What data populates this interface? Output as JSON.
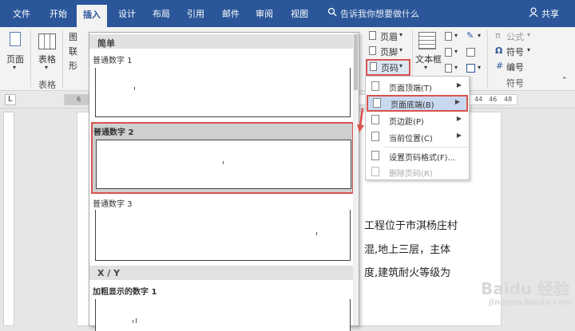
{
  "tabs": [
    {
      "label": "文件"
    },
    {
      "label": "开始"
    },
    {
      "label": "插入",
      "active": true
    },
    {
      "label": "设计"
    },
    {
      "label": "布局"
    },
    {
      "label": "引用"
    },
    {
      "label": "邮件"
    },
    {
      "label": "审阅"
    },
    {
      "label": "视图"
    }
  ],
  "tell_me": "告诉我你想要做什么",
  "share": "共享",
  "ribbon": {
    "page_label": "页面",
    "table_label": "表格",
    "table_group": "表格",
    "left_small": [
      "图",
      "联",
      "形"
    ],
    "header_btn": "页眉",
    "footer_btn": "页脚",
    "pagenum_btn": "页码",
    "textbox_btn": "文本框",
    "formula_btn": "公式",
    "symbol_btn": "符号",
    "number_btn": "编号",
    "symbols_group": "符号",
    "pi": "π",
    "omega": "Ω",
    "hash": "#"
  },
  "ruler": {
    "left_num": "6",
    "right_nums": [
      "44",
      "46",
      "48"
    ],
    "tab_stop": "L"
  },
  "gallery": {
    "section_simple": "简单",
    "item1": "普通数字 1",
    "item2": "普通数字 2",
    "item3": "普通数字 3",
    "section_xy": "X / Y",
    "item4": "加粗显示的数字 1"
  },
  "menu": {
    "items": [
      {
        "label": "页面顶端(T)",
        "submenu": true,
        "disabled": false
      },
      {
        "label": "页面底端(B)",
        "submenu": true,
        "disabled": false
      },
      {
        "label": "页边距(P)",
        "submenu": true,
        "disabled": false
      },
      {
        "label": "当前位置(C)",
        "submenu": true,
        "disabled": false
      },
      {
        "label": "设置页码格式(F)...",
        "submenu": false,
        "disabled": false
      },
      {
        "label": "删除页码(R)",
        "submenu": false,
        "disabled": true
      }
    ]
  },
  "document": {
    "lines": [
      "工程位于市淇杨庄村",
      "混,地上三层，主体",
      "度,建筑耐火等级为"
    ]
  },
  "watermark": {
    "brand": "Baidu 经验",
    "url": "jingyan.baidu.com"
  },
  "colors": {
    "accent": "#2b579a",
    "highlight": "#d9534f"
  }
}
